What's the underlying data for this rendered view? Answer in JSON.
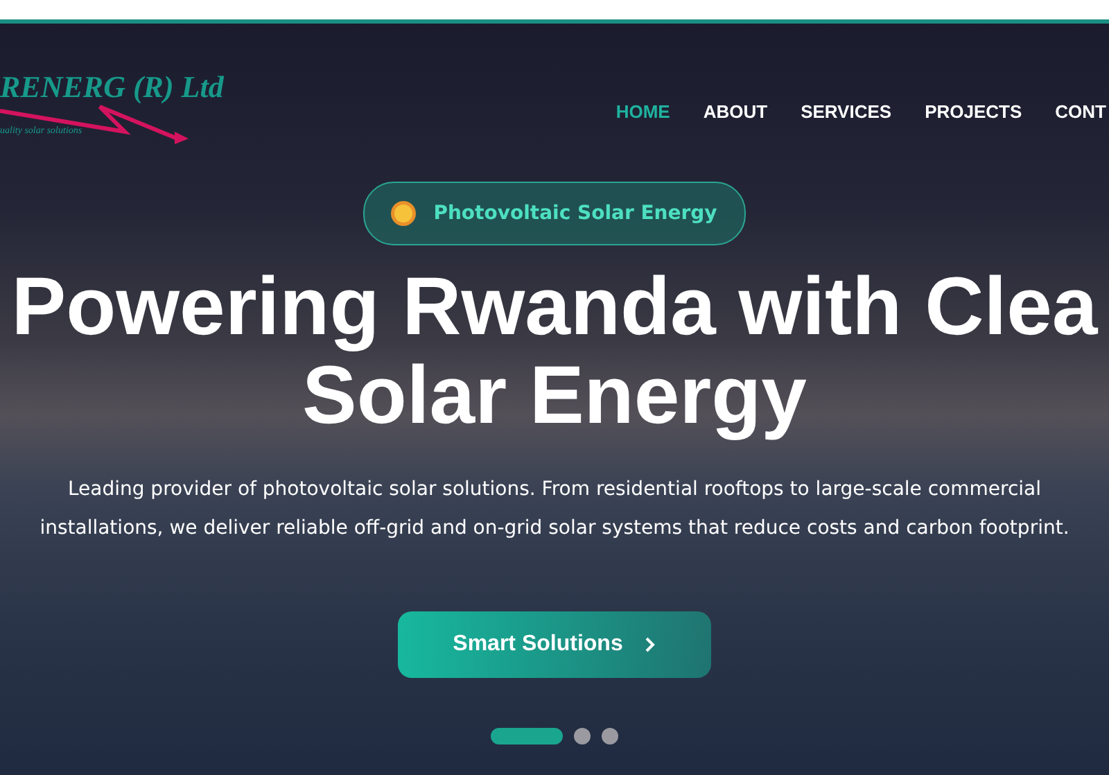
{
  "logo": {
    "name": "RENERG (R) Ltd",
    "tagline": "uality solar solutions"
  },
  "nav": [
    {
      "label": "HOME",
      "selected": true
    },
    {
      "label": "ABOUT",
      "selected": false
    },
    {
      "label": "SERVICES",
      "selected": false
    },
    {
      "label": "PROJECTS",
      "selected": false
    },
    {
      "label": "CONT",
      "selected": false
    }
  ],
  "badge": "Photovoltaic Solar Energy",
  "headline": [
    "Powering Rwanda with Clea",
    "Solar Energy"
  ],
  "description": "Leading provider of photovoltaic solar solutions. From residential rooftops to large-scale commercial installations, we deliver reliable off-grid and on-grid solar systems that reduce costs and carbon footprint.",
  "cta": "Smart Solutions",
  "slides": [
    {
      "selected": true
    },
    {
      "selected": false
    },
    {
      "selected": false
    }
  ]
}
